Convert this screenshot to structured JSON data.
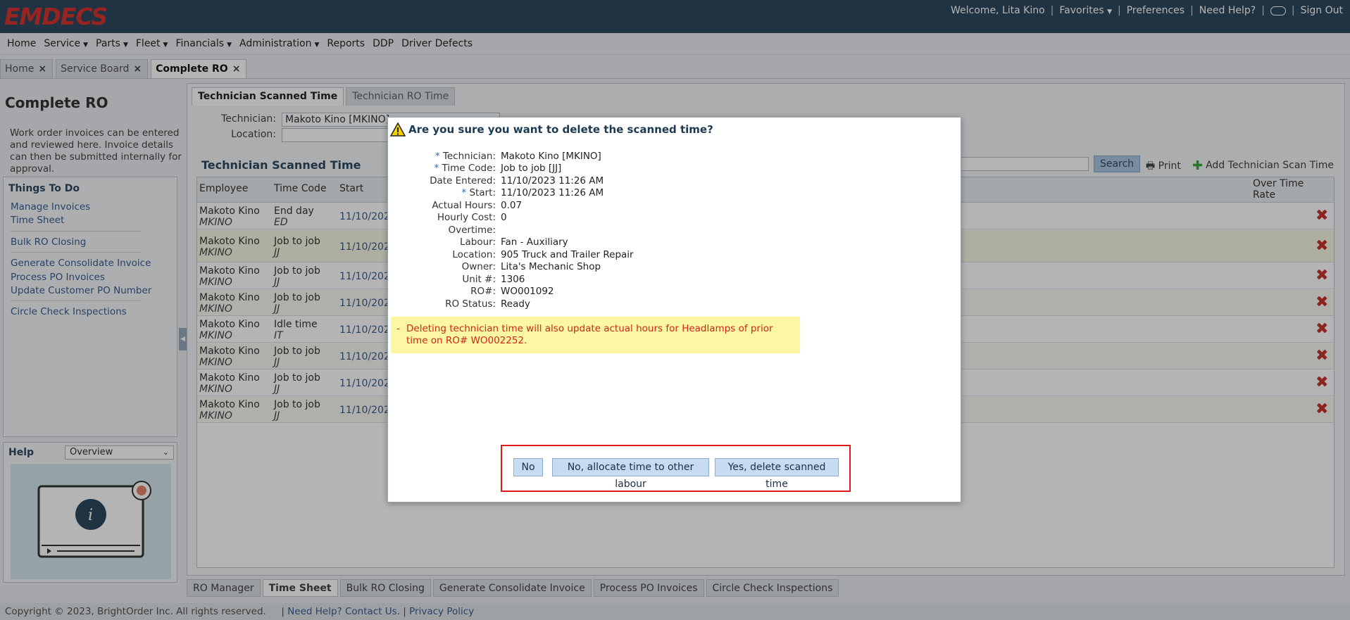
{
  "header": {
    "logo": "EMDECS",
    "welcome": "Welcome, Lita Kino",
    "favorites": "Favorites",
    "preferences": "Preferences",
    "need_help": "Need Help?",
    "sign_out": "Sign Out"
  },
  "menu": [
    "Home",
    "Service",
    "Parts",
    "Fleet",
    "Financials",
    "Administration",
    "Reports",
    "DDP",
    "Driver Defects"
  ],
  "page_tabs": [
    "Home",
    "Service Board",
    "Complete RO"
  ],
  "sidebar": {
    "title": "Complete RO",
    "description": "Work order invoices can be entered and reviewed here. Invoice details can then be submitted internally for approval.",
    "todo_title": "Things To Do",
    "todo_links": [
      "Manage Invoices",
      "Time Sheet",
      "Bulk RO Closing",
      "Generate Consolidate Invoice",
      "Process PO Invoices",
      "Update Customer PO Number",
      "Circle Check Inspections"
    ],
    "help_title": "Help",
    "help_select": "Overview"
  },
  "main": {
    "inner_tabs": [
      "Technician Scanned Time",
      "Technician RO Time"
    ],
    "technician_label": "Technician:",
    "technician_value": "Makoto Kino [MKINO]",
    "location_label": "Location:",
    "section_title": "Technician Scanned Time",
    "search": "Search",
    "print": "Print",
    "add": "Add Technician Scan Time",
    "columns": {
      "employee": "Employee",
      "time_code": "Time Code",
      "start": "Start",
      "ot_rate": "Over Time Rate"
    },
    "rows": [
      {
        "name": "Makoto Kino",
        "id": "MKINO",
        "code": "End day",
        "abbr": "ED",
        "start": "11/10/2023"
      },
      {
        "name": "Makoto Kino",
        "id": "MKINO",
        "code": "Job to job",
        "abbr": "JJ",
        "start": "11/10/2023"
      },
      {
        "name": "Makoto Kino",
        "id": "MKINO",
        "code": "Job to job",
        "abbr": "JJ",
        "start": "11/10/2023"
      },
      {
        "name": "Makoto Kino",
        "id": "MKINO",
        "code": "Job to job",
        "abbr": "JJ",
        "start": "11/10/2023"
      },
      {
        "name": "Makoto Kino",
        "id": "MKINO",
        "code": "Idle time",
        "abbr": "IT",
        "start": "11/10/2023"
      },
      {
        "name": "Makoto Kino",
        "id": "MKINO",
        "code": "Job to job",
        "abbr": "JJ",
        "start": "11/10/2023"
      },
      {
        "name": "Makoto Kino",
        "id": "MKINO",
        "code": "Job to job",
        "abbr": "JJ",
        "start": "11/10/2023"
      },
      {
        "name": "Makoto Kino",
        "id": "MKINO",
        "code": "Job to job",
        "abbr": "JJ",
        "start": "11/10/2023"
      }
    ]
  },
  "bottom_tabs": [
    "RO Manager",
    "Time Sheet",
    "Bulk RO Closing",
    "Generate Consolidate Invoice",
    "Process PO Invoices",
    "Circle Check Inspections"
  ],
  "footer": {
    "copyright": "Copyright © 2023, BrightOrder Inc. All rights reserved.",
    "contact": "Need Help? Contact Us.",
    "privacy": "Privacy Policy"
  },
  "dialog": {
    "title": "Are you sure you want to delete the scanned time?",
    "fields": [
      {
        "req": "* ",
        "label": "Technician:",
        "value": "Makoto Kino [MKINO]"
      },
      {
        "req": "* ",
        "label": "Time Code:",
        "value": "Job to job [JJ]"
      },
      {
        "req": "",
        "label": "Date Entered:",
        "value": "11/10/2023 11:26 AM"
      },
      {
        "req": "* ",
        "label": "Start:",
        "value": "11/10/2023 11:26 AM"
      },
      {
        "req": "",
        "label": "Actual Hours:",
        "value": "0.07"
      },
      {
        "req": "",
        "label": "Hourly Cost:",
        "value": "0"
      },
      {
        "req": "",
        "label": "Overtime:",
        "value": ""
      },
      {
        "req": "",
        "label": "Labour:",
        "value": "Fan - Auxiliary"
      },
      {
        "req": "",
        "label": "Location:",
        "value": "905 Truck and Trailer Repair"
      },
      {
        "req": "",
        "label": "Owner:",
        "value": "Lita's Mechanic Shop"
      },
      {
        "req": "",
        "label": "Unit #:",
        "value": "1306"
      },
      {
        "req": "",
        "label": "RO#:",
        "value": "WO001092"
      },
      {
        "req": "",
        "label": "RO Status:",
        "value": "Ready"
      }
    ],
    "warning_dash": "-",
    "warning": "Deleting technician time will also update actual hours for Headlamps of prior time on RO# WO002252.",
    "buttons": {
      "no": "No",
      "allocate": "No, allocate time to other labour",
      "yes": "Yes, delete scanned time"
    }
  }
}
